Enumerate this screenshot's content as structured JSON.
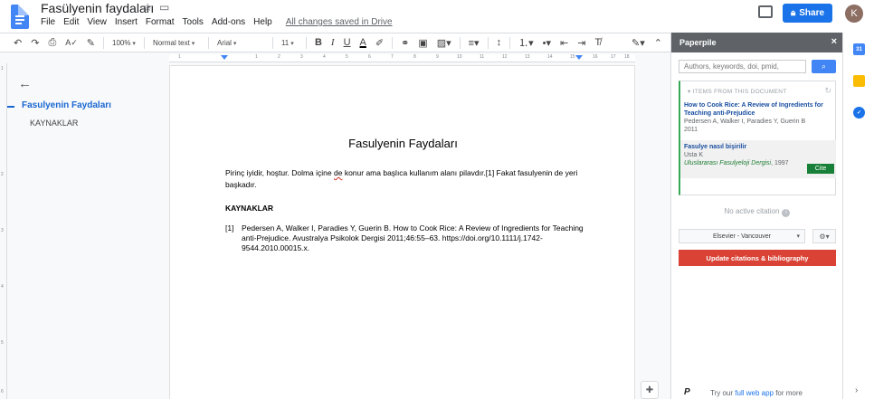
{
  "app": {
    "doc_title": "Fasülyenin faydaları",
    "menu": [
      "File",
      "Edit",
      "View",
      "Insert",
      "Format",
      "Tools",
      "Add-ons",
      "Help"
    ],
    "saved_status": "All changes saved in Drive",
    "share_label": "Share",
    "avatar_initial": "K"
  },
  "toolbar": {
    "zoom": "100%",
    "style": "Normal text",
    "font": "Arial",
    "font_size": "11",
    "bold": "B",
    "italic": "I",
    "underline": "U",
    "text_color": "A"
  },
  "ruler": {
    "numbers": [
      "1",
      "1",
      "2",
      "3",
      "4",
      "5",
      "6",
      "7",
      "8",
      "9",
      "10",
      "11",
      "12",
      "13",
      "14",
      "15",
      "16",
      "17",
      "18"
    ],
    "vertical_numbers": [
      "1",
      "2",
      "3",
      "4",
      "5",
      "6"
    ]
  },
  "outline": {
    "title": "Fasulyenin Faydaları",
    "item": "KAYNAKLAR"
  },
  "document": {
    "title": "Fasulyenin Faydaları",
    "para_before": "Pirinç iyidir, hoştur. Dolma içine ",
    "para_misspelled": "de",
    "para_after": " konur ama başlıca kullanım alanı pilavdır.[1] Fakat fasulyenin de yeri başkadır.",
    "heading": "KAYNAKLAR",
    "ref_num": "[1]",
    "ref_text": "Pedersen A, Walker I, Paradies Y, Guerin B. How to Cook Rice: A Review of Ingredients for Teaching anti-Prejudice. Avustralya Psikolok Dergisi 2011;46:55–63. https://doi.org/10.1111/j.1742-9544.2010.00015.x."
  },
  "paperpile": {
    "title": "Paperpile",
    "close": "×",
    "search_placeholder": "Authors, keywords, doi, pmid,",
    "list_header": "ITEMS FROM THIS DOCUMENT",
    "item1": {
      "title": "How to Cook Rice: A Review of Ingredients for Teaching anti-Prejudice",
      "authors": "Pedersen A, Walker I, Paradies Y, Guerin B",
      "year": "2011"
    },
    "item2": {
      "title": "Fasulye nasıl bişirilir",
      "authors": "Usta K",
      "journal": "Uluslararası Fasulyeloji Dergisi",
      "year": ", 1997",
      "cite_label": "Cite"
    },
    "no_active": "No active citation",
    "citation_style": "Elsevier - Vancouver",
    "update_label": "Update citations & bibliography",
    "footer_prefix": "Try our ",
    "footer_link": "full web app",
    "footer_suffix": " for more",
    "footer_logo": "P"
  },
  "rail": {
    "calendar_label": "31",
    "colors": {
      "calendar": "#4285f4",
      "keep": "#fbbc04",
      "tasks": "#1a73e8"
    }
  },
  "colors": {
    "accent": "#1a73e8",
    "update": "#d94235",
    "cite": "#188038"
  }
}
